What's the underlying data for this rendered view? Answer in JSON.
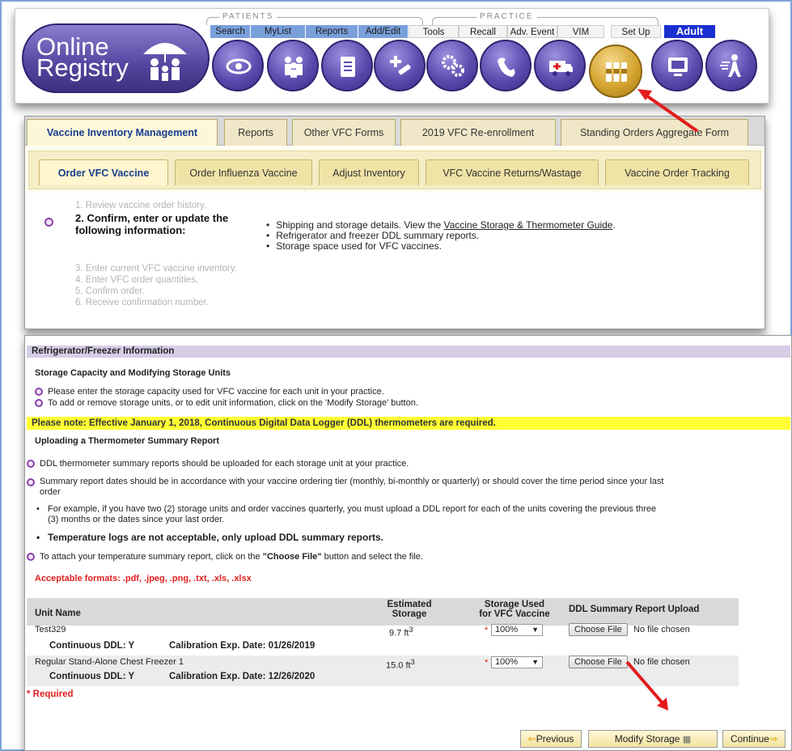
{
  "nav": {
    "logo_text_1": "Online",
    "logo_text_2": "Registry",
    "group_patients": "PATIENTS",
    "group_practice": "PRACTICE",
    "tabs": [
      "Search",
      "MyList",
      "Reports",
      "Add/Edit",
      "Tools",
      "Recall",
      "Adv. Event",
      "VIM",
      "Set Up",
      "Adult"
    ]
  },
  "main_tabs": [
    "Vaccine Inventory Management",
    "Reports",
    "Other VFC Forms",
    "2019 VFC Re-enrollment",
    "Standing Orders Aggregate Form"
  ],
  "sub_tabs": [
    "Order VFC Vaccine",
    "Order Influenza Vaccine",
    "Adjust Inventory",
    "VFC Vaccine Returns/Wastage",
    "Vaccine Order Tracking"
  ],
  "steps": {
    "step1": "1. Review vaccine order history.",
    "step2_line1": "2. Confirm, enter or update the",
    "step2_line2": "following information:",
    "step3": "3. Enter current VFC vaccine inventory.",
    "step4": "4. Enter VFC order quantities.",
    "step5": "5. Confirm order.",
    "step6": "6. Receive confirmation number.",
    "info_1_prefix": "Shipping and storage details. View the ",
    "info_1_link": "Vaccine Storage & Thermometer Guide",
    "info_1_suffix": ".",
    "info_2": "Refrigerator and freezer DDL summary reports.",
    "info_3": "Storage space used for VFC vaccines."
  },
  "ref": {
    "header": "Refrigerator/Freezer Information",
    "section_title": "Storage Capacity and Modifying Storage Units",
    "bullet_1": "Please enter the storage capacity used for VFC vaccine for each unit in your practice.",
    "bullet_2": "To add or remove storage units, or to edit unit information, click on the 'Modify Storage' button.",
    "note": "Please note: Effective January 1, 2018, Continuous Digital Data Logger (DDL) thermometers are required.",
    "upload_title": "Uploading a Thermometer Summary Report",
    "upload_1": "DDL thermometer summary reports should be uploaded for each storage unit at your practice.",
    "upload_2a": "Summary report dates should be in accordance with your vaccine ordering tier (monthly, bi-monthly or quarterly) or should cover the time period since your last",
    "upload_2b": "order",
    "example_a": "For example, if you have two (2) storage units and order vaccines quarterly, you must upload a DDL report for each of the units covering the previous three",
    "example_b": "(3) months or the dates since your last order.",
    "temp_logs": "Temperature logs are not acceptable, only upload DDL summary reports.",
    "attach_prefix": "To attach your temperature summary report, click on the ",
    "attach_bold": "\"Choose File\"",
    "attach_suffix": " button and select the file.",
    "formats": "Acceptable formats: .pdf, .jpeg, .png, .txt, .xls, .xlsx",
    "col_unit": "Unit Name",
    "col_est_1": "Estimated",
    "col_est_2": "Storage",
    "col_used_1": "Storage Used",
    "col_used_2": "for VFC Vaccine",
    "col_upload": "DDL Summary Report Upload",
    "units": [
      {
        "name": "Test329",
        "storage": "9.7 ft",
        "sup": "3",
        "used": "100%",
        "ddl": "Continuous DDL: Y",
        "calib": "Calibration Exp. Date: 01/26/2019",
        "file_btn": "Choose File",
        "file_status": "No file chosen"
      },
      {
        "name": "Regular Stand-Alone Chest Freezer 1",
        "storage": "15.0 ft",
        "sup": "3",
        "used": "100%",
        "ddl": "Continuous DDL: Y",
        "calib": "Calibration Exp. Date: 12/26/2020",
        "file_btn": "Choose File",
        "file_status": "No file chosen"
      }
    ],
    "required": "* Required",
    "asterisk": "*",
    "btn_previous": "Previous",
    "btn_modify": "Modify Storage",
    "btn_continue": "Continue"
  }
}
